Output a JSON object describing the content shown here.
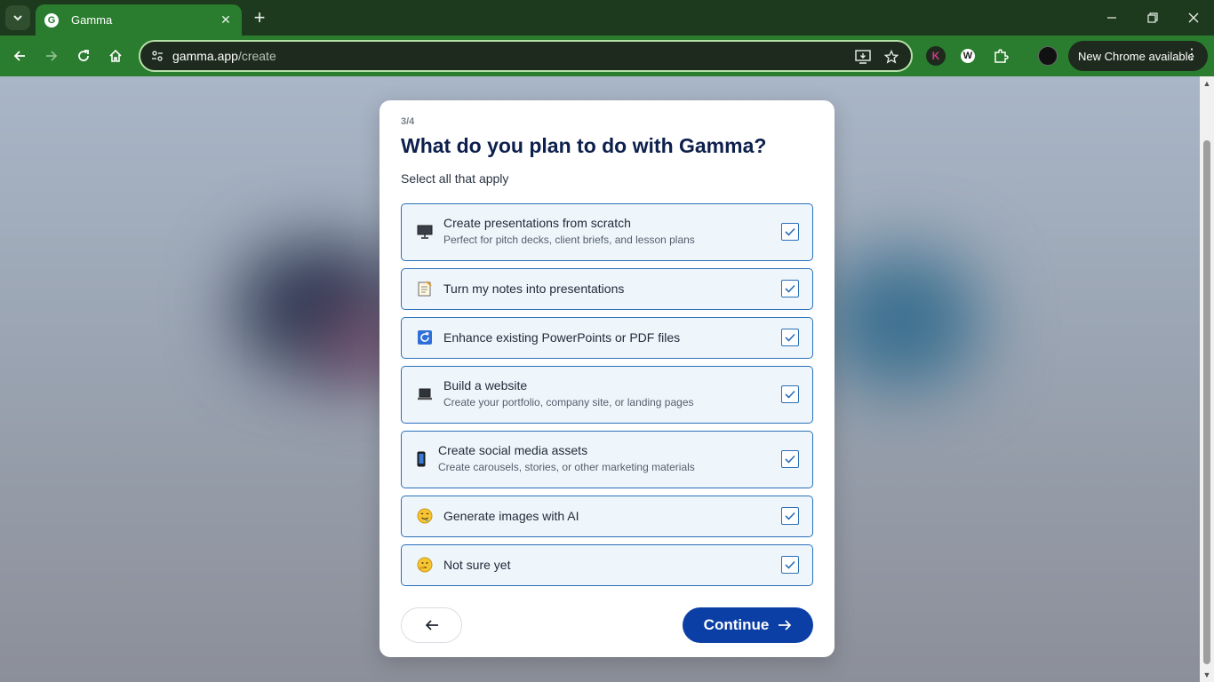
{
  "browser": {
    "tab_title": "Gamma",
    "tab_favicon_letter": "G",
    "url_host": "gamma.app",
    "url_path": "/create",
    "update_button": "New Chrome available",
    "extensions": [
      "K",
      "W"
    ]
  },
  "modal": {
    "step": "3/4",
    "title": "What do you plan to do with Gamma?",
    "subtitle": "Select all that apply",
    "options": [
      {
        "label": "Create presentations from scratch",
        "desc": "Perfect for pitch decks, client briefs, and lesson plans",
        "icon": "presentation-screen-icon",
        "checked": true
      },
      {
        "label": "Turn my notes into presentations",
        "desc": "",
        "icon": "notes-icon",
        "checked": true
      },
      {
        "label": "Enhance existing PowerPoints or PDF files",
        "desc": "",
        "icon": "refresh-icon",
        "checked": true
      },
      {
        "label": "Build a website",
        "desc": "Create your portfolio, company site, or landing pages",
        "icon": "laptop-icon",
        "checked": true
      },
      {
        "label": "Create social media assets",
        "desc": "Create carousels, stories, or other marketing materials",
        "icon": "phone-icon",
        "checked": true
      },
      {
        "label": "Generate images with AI",
        "desc": "",
        "icon": "drooling-face-icon",
        "checked": true
      },
      {
        "label": "Not sure yet",
        "desc": "",
        "icon": "thinking-face-icon",
        "checked": true
      }
    ],
    "continue_label": "Continue",
    "accent_color": "#0b3fa6",
    "option_border_color": "#2a6fb8"
  }
}
